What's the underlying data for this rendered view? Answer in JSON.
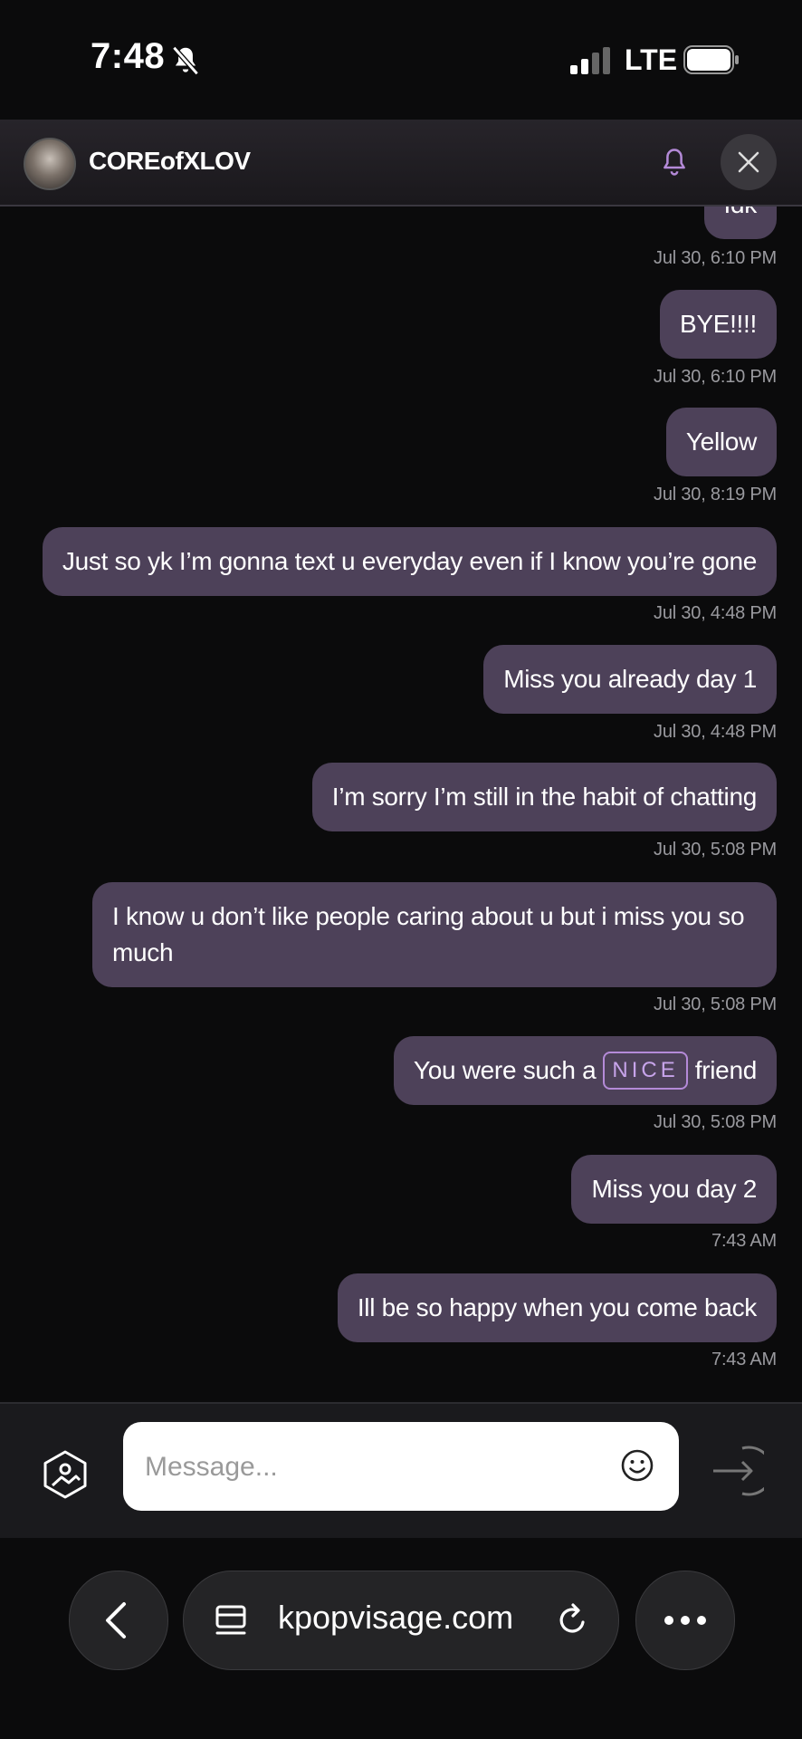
{
  "status_bar": {
    "time": "7:48",
    "network": "LTE"
  },
  "chat": {
    "username": "COREofXLOV",
    "messages": [
      {
        "text": "Idk",
        "time": "Jul 30, 6:10 PM"
      },
      {
        "text": "BYE!!!!",
        "time": "Jul 30, 6:10 PM"
      },
      {
        "text": "Yellow",
        "time": "Jul 30, 8:19 PM"
      },
      {
        "text": "Just so yk I’m gonna text u everyday even if I know you’re gone",
        "time": "Jul 30, 4:48 PM"
      },
      {
        "text": "Miss you already day 1",
        "time": "Jul 30, 4:48 PM"
      },
      {
        "text": "I’m sorry I’m still in the habit of chatting",
        "time": "Jul 30, 5:08 PM"
      },
      {
        "text": "I know u don’t like people caring about u but i miss you so much",
        "time": "Jul 30, 5:08 PM"
      },
      {
        "text_before": "You were such a",
        "tag": "NICE",
        "text_after": "friend",
        "time": "Jul 30, 5:08 PM"
      },
      {
        "text": "Miss you day 2",
        "time": "7:43 AM"
      },
      {
        "text": "Ill be so happy when you come back",
        "time": "7:43 AM"
      }
    ]
  },
  "composer": {
    "placeholder": "Message..."
  },
  "browser": {
    "url": "kpopvisage.com"
  },
  "colors": {
    "bubble": "#4d4159",
    "accent": "#b48ad8",
    "background": "#0b0b0c"
  }
}
